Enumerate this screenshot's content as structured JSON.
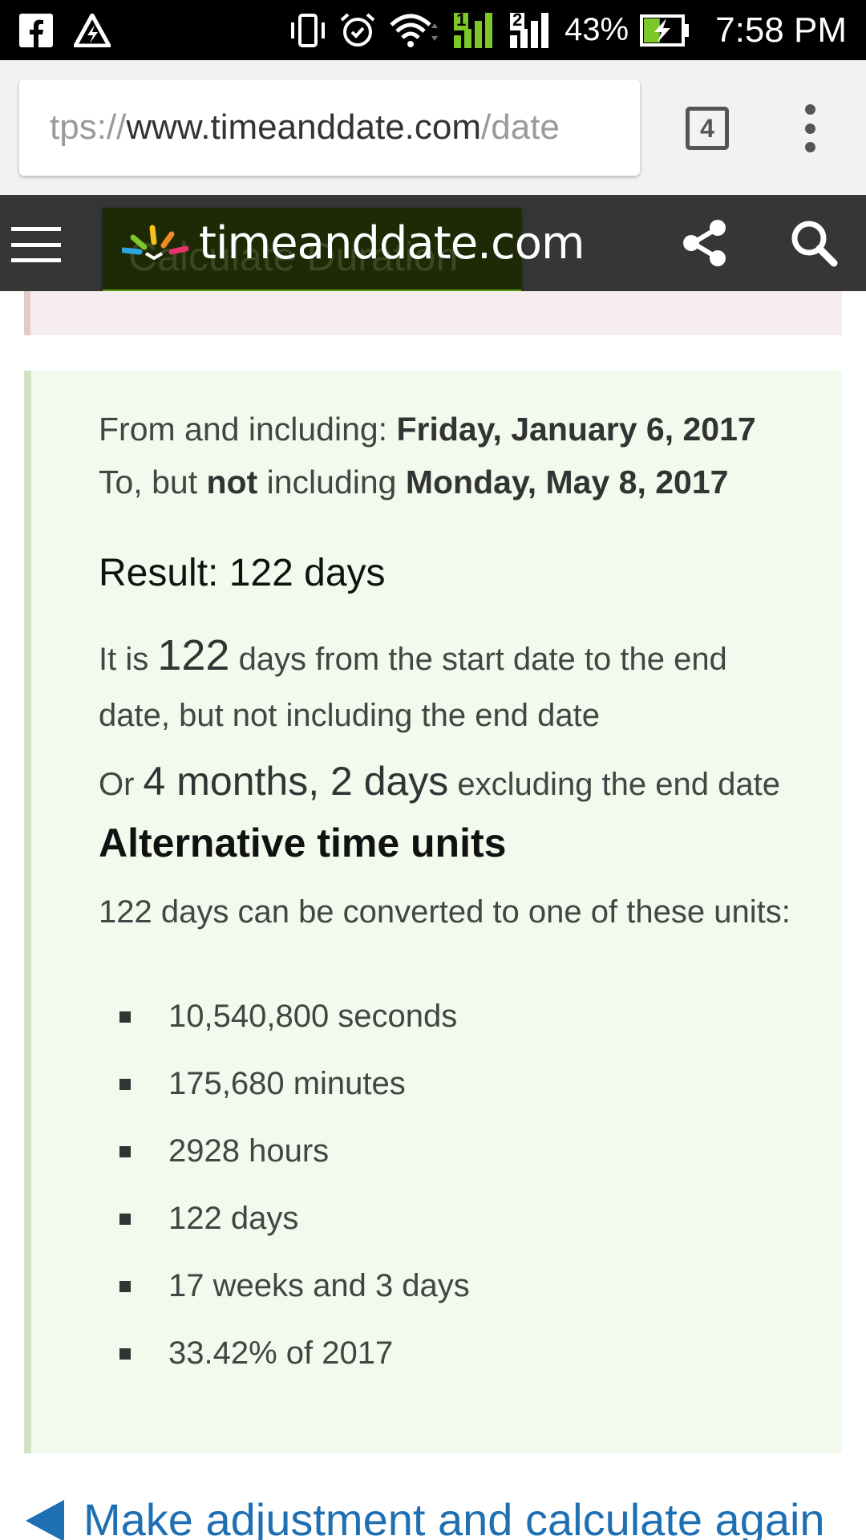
{
  "status_bar": {
    "icons_left": [
      "facebook-icon",
      "warning-icon"
    ],
    "icons_right": [
      "vibrate-icon",
      "alarm-icon",
      "wifi-icon",
      "signal-sim1-icon",
      "signal-sim2-icon"
    ],
    "sim1_label": "1",
    "sim2_label": "2",
    "battery_percent": "43%",
    "battery_level": 0.43,
    "charging": true,
    "time": "7:58 PM",
    "colors": {
      "signal_sim1": "#7dc728",
      "charging": "#7dc728"
    }
  },
  "browser": {
    "url_prefix": "tps://",
    "url_host": "www.timeanddate.com",
    "url_suffix": "/date",
    "tab_count": "4",
    "menu_icon": "more-vert-icon"
  },
  "site": {
    "logo_text": "timeanddate.com",
    "behind_button_text": "Calculate Duration",
    "colors": {
      "header_bg": "#363636",
      "button_bg": "#1e2a06",
      "button_border": "#5d9a13"
    }
  },
  "result": {
    "from_label": "From and including: ",
    "from_date": "Friday, January 6, 2017",
    "to_prefix": "To, but ",
    "to_not": "not",
    "to_mid": " including ",
    "to_date": "Monday, May 8, 2017",
    "title": "Result: 122 days",
    "para1_prefix": "It is ",
    "para1_number": "122",
    "para1_suffix": " days from the start date to the end date, but not including the end date",
    "para2_prefix": "Or ",
    "para2_value": "4 months, 2 days",
    "para2_suffix": " excluding the end date",
    "colors": {
      "panel_bg": "#f1faec",
      "panel_border": "#cfe3c4"
    }
  },
  "alternative": {
    "title": "Alternative time units",
    "intro": "122 days can be converted to one of these units:",
    "items": [
      "10,540,800 seconds",
      "175,680 minutes",
      "2928 hours",
      "122 days",
      "17 weeks and 3 days",
      "33.42% of 2017"
    ]
  },
  "footer": {
    "link_text": "Make adjustment and calculate again",
    "colors": {
      "link": "#1f6fb3"
    }
  }
}
